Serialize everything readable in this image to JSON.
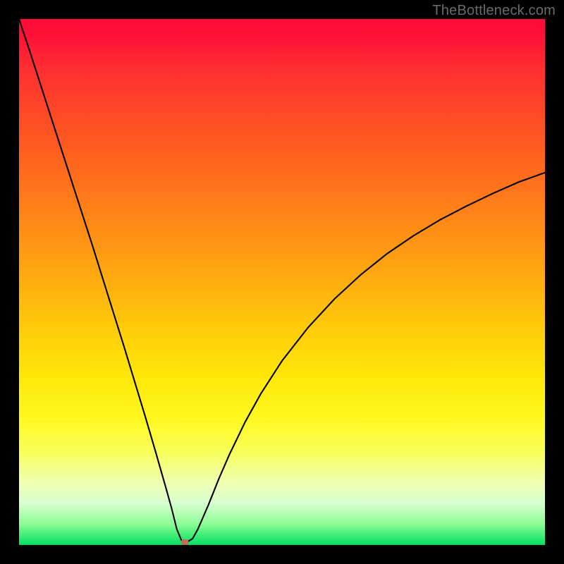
{
  "attribution": "TheBottleneck.com",
  "chart_data": {
    "type": "line",
    "title": "",
    "xlabel": "",
    "ylabel": "",
    "xlim": [
      0,
      100
    ],
    "ylim": [
      0,
      100
    ],
    "series": [
      {
        "name": "bottleneck-curve",
        "x": [
          0.0,
          2.0,
          4.0,
          6.0,
          8.0,
          10.0,
          12.0,
          14.0,
          16.0,
          18.0,
          20.0,
          22.0,
          24.0,
          26.0,
          28.0,
          29.0,
          30.0,
          31.0,
          32.0,
          33.0,
          34.0,
          36.0,
          38.0,
          40.0,
          43.0,
          46.0,
          50.0,
          55.0,
          60.0,
          65.0,
          70.0,
          75.0,
          80.0,
          85.0,
          90.0,
          95.0,
          100.0
        ],
        "y": [
          100.0,
          94.0,
          87.8,
          81.6,
          75.4,
          69.2,
          63.0,
          56.8,
          50.4,
          44.0,
          37.6,
          31.0,
          24.4,
          17.6,
          10.6,
          7.0,
          3.0,
          0.6,
          0.6,
          1.2,
          3.0,
          7.6,
          12.6,
          17.2,
          23.4,
          28.8,
          35.0,
          41.4,
          46.8,
          51.4,
          55.4,
          58.8,
          61.8,
          64.4,
          66.8,
          69.0,
          70.8
        ]
      }
    ],
    "marker": {
      "x": 31.5,
      "y": 0.6
    },
    "background_gradient": {
      "top": "#ff0a3a",
      "mid": "#ffd600",
      "bottom": "#00e060"
    }
  }
}
